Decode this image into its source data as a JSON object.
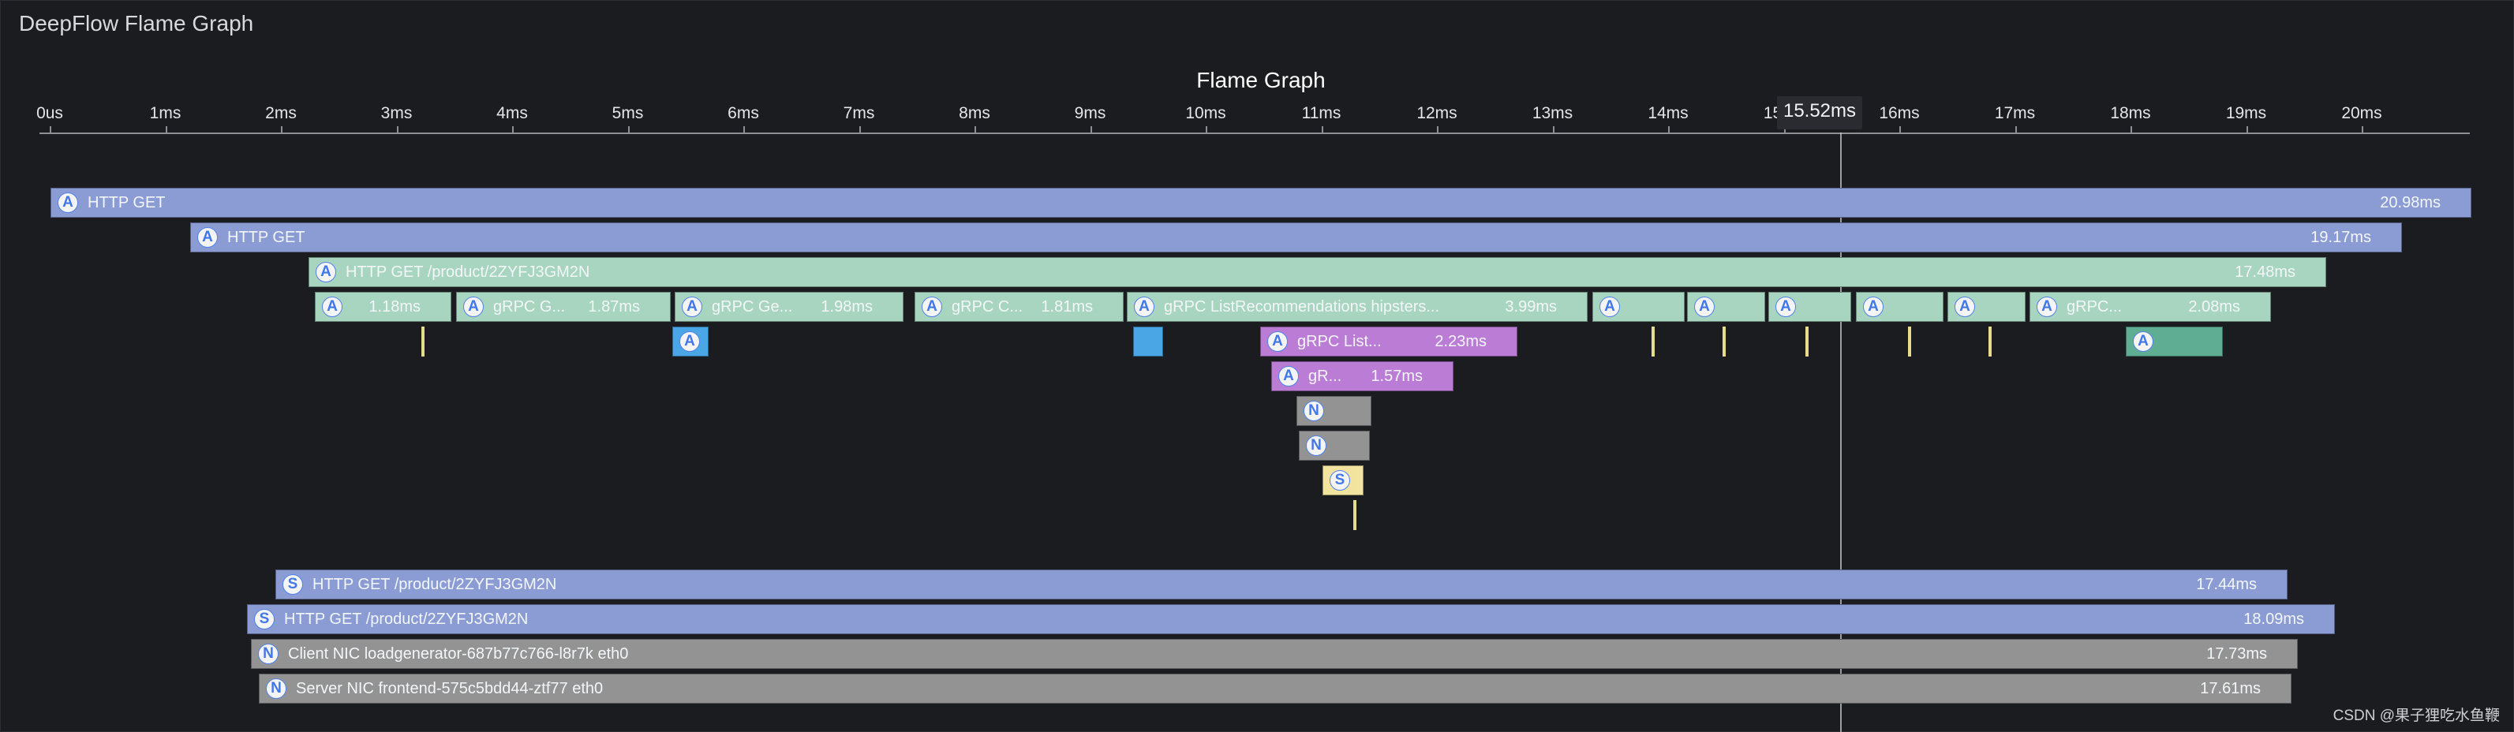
{
  "panel_title": "DeepFlow Flame Graph",
  "chart_title": "Flame Graph",
  "axis_ticks": [
    "0us",
    "1ms",
    "2ms",
    "3ms",
    "4ms",
    "5ms",
    "6ms",
    "7ms",
    "8ms",
    "9ms",
    "10ms",
    "11ms",
    "12ms",
    "13ms",
    "14ms",
    "15ms",
    "16ms",
    "17ms",
    "18ms",
    "19ms",
    "20ms"
  ],
  "cursor_label": "15.52ms",
  "spans": [
    {
      "icon": "A",
      "label": "HTTP GET",
      "duration": "20.98ms",
      "color": "blue",
      "row": 0
    },
    {
      "icon": "A",
      "label": "HTTP GET",
      "duration": "19.17ms",
      "color": "blue",
      "row": 1
    },
    {
      "icon": "A",
      "label": "HTTP GET /product/2ZYFJ3GM2N",
      "duration": "17.48ms",
      "color": "green",
      "row": 2
    },
    {
      "icon": "A",
      "label": "",
      "duration": "1.18ms",
      "color": "green",
      "row": 3
    },
    {
      "icon": "A",
      "label": "gRPC G...",
      "duration": "1.87ms",
      "color": "green",
      "row": 3
    },
    {
      "icon": "A",
      "label": "gRPC Ge...",
      "duration": "1.98ms",
      "color": "green",
      "row": 3
    },
    {
      "icon": "A",
      "label": "gRPC C...",
      "duration": "1.81ms",
      "color": "green",
      "row": 3
    },
    {
      "icon": "A",
      "label": "gRPC ListRecommendations hipsters...",
      "duration": "3.99ms",
      "color": "green",
      "row": 3
    },
    {
      "icon": "A",
      "label": "",
      "duration": "",
      "color": "green",
      "row": 3
    },
    {
      "icon": "A",
      "label": "",
      "duration": "",
      "color": "green",
      "row": 3
    },
    {
      "icon": "A",
      "label": "",
      "duration": "",
      "color": "green",
      "row": 3
    },
    {
      "icon": "A",
      "label": "",
      "duration": "",
      "color": "green",
      "row": 3
    },
    {
      "icon": "A",
      "label": "",
      "duration": "",
      "color": "green",
      "row": 3
    },
    {
      "icon": "A",
      "label": "gRPC...",
      "duration": "2.08ms",
      "color": "green",
      "row": 3
    },
    {
      "icon": "A",
      "label": "",
      "duration": "",
      "color": "bright",
      "row": 4
    },
    {
      "icon": "",
      "label": "",
      "duration": "",
      "color": "bright",
      "row": 4
    },
    {
      "icon": "A",
      "label": "gRPC List...",
      "duration": "2.23ms",
      "color": "purple",
      "row": 4
    },
    {
      "icon": "A",
      "label": "",
      "duration": "",
      "color": "teal",
      "row": 4
    },
    {
      "icon": "A",
      "label": "gR...",
      "duration": "1.57ms",
      "color": "purple",
      "row": 5
    },
    {
      "icon": "N",
      "label": "",
      "duration": "",
      "color": "gray",
      "row": 6
    },
    {
      "icon": "N",
      "label": "",
      "duration": "",
      "color": "gray",
      "row": 7
    },
    {
      "icon": "S",
      "label": "",
      "duration": "",
      "color": "yellow",
      "row": 8
    },
    {
      "icon": "S",
      "label": "HTTP GET /product/2ZYFJ3GM2N",
      "duration": "17.44ms",
      "color": "blue",
      "row": 11
    },
    {
      "icon": "S",
      "label": "HTTP GET /product/2ZYFJ3GM2N",
      "duration": "18.09ms",
      "color": "blue",
      "row": 12
    },
    {
      "icon": "N",
      "label": "Client NIC loadgenerator-687b77c766-l8r7k eth0",
      "duration": "17.73ms",
      "color": "gray",
      "row": 13
    },
    {
      "icon": "N",
      "label": "Server NIC frontend-575c5bdd44-ztf77 eth0",
      "duration": "17.61ms",
      "color": "gray",
      "row": 14
    }
  ],
  "watermark": "CSDN @果子狸吃水鱼鞭"
}
